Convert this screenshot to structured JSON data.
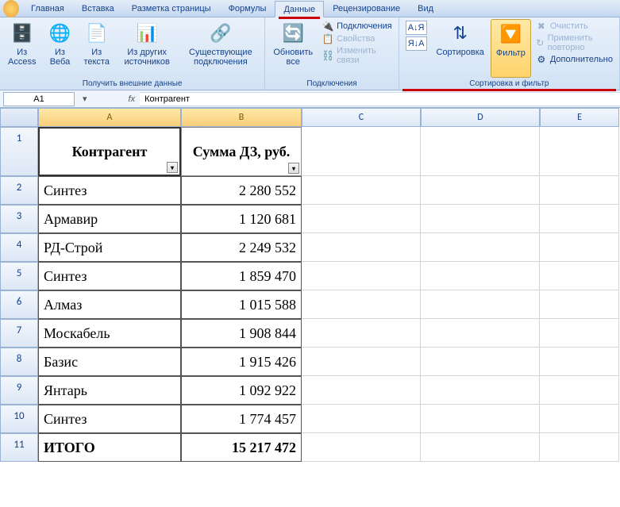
{
  "tabs": [
    "Главная",
    "Вставка",
    "Разметка страницы",
    "Формулы",
    "Данные",
    "Рецензирование",
    "Вид"
  ],
  "active_tab_index": 4,
  "ribbon": {
    "ext_data": {
      "access": "Из Access",
      "web": "Из Веба",
      "text": "Из текста",
      "other": "Из других источников",
      "existing": "Существующие подключения",
      "title": "Получить внешние данные"
    },
    "connections": {
      "refresh": "Обновить все",
      "conn": "Подключения",
      "props": "Свойства",
      "editlinks": "Изменить связи",
      "title": "Подключения"
    },
    "sort": {
      "az": "А↓Я",
      "za": "Я↓А",
      "sortbtn": "Сортировка",
      "filter": "Фильтр",
      "clear": "Очистить",
      "reapply": "Применить повторно",
      "advanced": "Дополнительно",
      "title": "Сортировка и фильтр"
    }
  },
  "formula_bar": {
    "cellref": "A1",
    "fx": "fx",
    "value": "Контрагент"
  },
  "columns": [
    "A",
    "B",
    "C",
    "D",
    "E"
  ],
  "header_row": {
    "a": "Контрагент",
    "b": "Сумма ДЗ, руб."
  },
  "rows": [
    {
      "a": "Синтез",
      "b": "2 280 552"
    },
    {
      "a": "Армавир",
      "b": "1 120 681"
    },
    {
      "a": "РД-Строй",
      "b": "2 249 532"
    },
    {
      "a": "Синтез",
      "b": "1 859 470"
    },
    {
      "a": "Алмаз",
      "b": "1 015 588"
    },
    {
      "a": "Москабель",
      "b": "1 908 844"
    },
    {
      "a": "Базис",
      "b": "1 915 426"
    },
    {
      "a": "Янтарь",
      "b": "1 092 922"
    },
    {
      "a": "Синтез",
      "b": "1 774 457"
    }
  ],
  "total_row": {
    "a": "ИТОГО",
    "b": "15 217 472"
  },
  "icons": {
    "access": "🗄️",
    "web": "🌐",
    "text": "📄",
    "other": "📊",
    "existing": "🔗",
    "refresh": "🔄",
    "conn": "🔌",
    "props": "📋",
    "links": "⛓️",
    "az": "A↓",
    "za": "Z↓",
    "sort": "⇅",
    "filter": "▼",
    "clear": "✖",
    "reapply": "↻",
    "adv": "⚙"
  }
}
